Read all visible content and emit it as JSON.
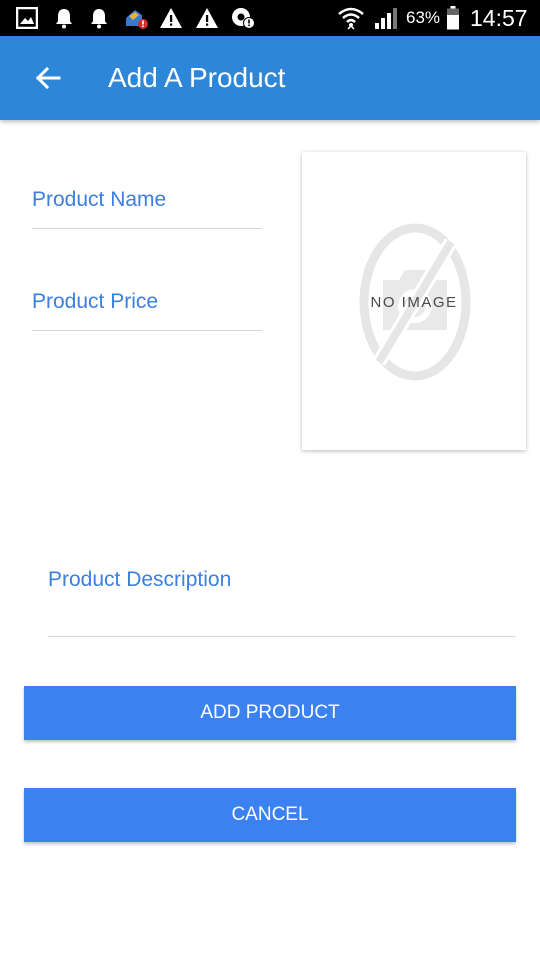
{
  "status_bar": {
    "battery_percent": "63%",
    "time": "14:57",
    "icons": [
      "gallery-icon",
      "notification-bell-icon",
      "notification-bell-icon",
      "app-alert-icon",
      "warning-icon",
      "warning-icon",
      "settings-alert-icon",
      "wifi-icon",
      "signal-icon",
      "battery-icon"
    ]
  },
  "app_bar": {
    "title": "Add A Product",
    "back_icon": "arrow-back-icon",
    "color": "#2d86d8"
  },
  "form": {
    "product_name": {
      "label": "Product Name",
      "value": ""
    },
    "product_price": {
      "label": "Product Price",
      "value": ""
    },
    "product_description": {
      "label": "Product Description",
      "value": ""
    }
  },
  "image_placeholder": {
    "text": "NO IMAGE"
  },
  "buttons": {
    "add": "ADD PRODUCT",
    "cancel": "CANCEL",
    "color": "#3b82f0"
  },
  "colors": {
    "label": "#3b7fe0",
    "divider": "#d6d6d6"
  }
}
